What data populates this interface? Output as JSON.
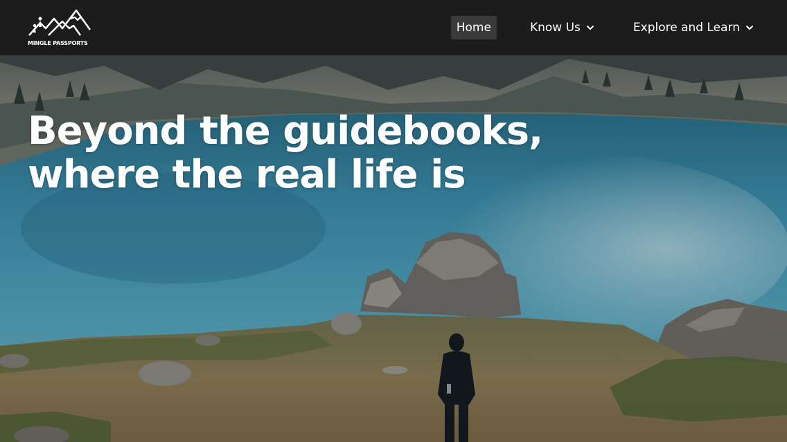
{
  "brand": {
    "logo_text": "MINGLE PASSPORTS",
    "logo_icon": "mountain-icon"
  },
  "nav": {
    "items": [
      {
        "label": "Home",
        "active": true
      },
      {
        "label": "Know Us",
        "has_dropdown": true,
        "icon": "chevron-down-icon"
      },
      {
        "label": "Explore and Learn",
        "has_dropdown": true,
        "icon": "chevron-down-icon"
      }
    ]
  },
  "hero": {
    "headline_line1": "Beyond the guidebooks,",
    "headline_line2": "where the real life is"
  },
  "colors": {
    "navbar_bg": "#1c1c1c",
    "active_tab_bg": "#3a3a3a",
    "text": "#ffffff",
    "lake": "#3b8aa6"
  }
}
